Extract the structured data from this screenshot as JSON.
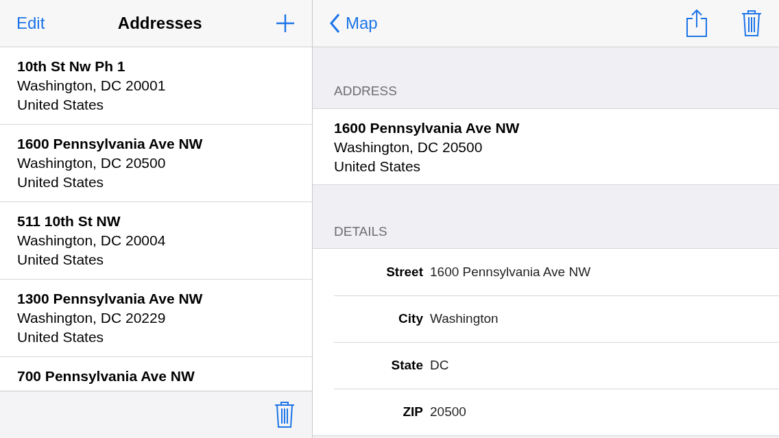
{
  "list_nav": {
    "edit": "Edit",
    "title": "Addresses"
  },
  "addresses": [
    {
      "street": "10th St Nw Ph 1",
      "city_line": "Washington, DC 20001",
      "country": "United States"
    },
    {
      "street": "1600 Pennsylvania Ave NW",
      "city_line": "Washington, DC 20500",
      "country": "United States"
    },
    {
      "street": "511 10th St NW",
      "city_line": "Washington, DC 20004",
      "country": "United States"
    },
    {
      "street": "1300 Pennsylvania Ave NW",
      "city_line": "Washington, DC 20229",
      "country": "United States"
    },
    {
      "street": "700 Pennsylvania Ave NW"
    }
  ],
  "detail_nav": {
    "back": "Map"
  },
  "address_section": {
    "header": "ADDRESS",
    "street": "1600 Pennsylvania Ave NW",
    "city_line": "Washington, DC 20500",
    "country": "United States"
  },
  "details_section": {
    "header": "DETAILS",
    "fields": [
      {
        "label": "Street",
        "value": "1600 Pennsylvania Ave NW"
      },
      {
        "label": "City",
        "value": "Washington"
      },
      {
        "label": "State",
        "value": "DC"
      },
      {
        "label": "ZIP",
        "value": "20500"
      }
    ]
  }
}
